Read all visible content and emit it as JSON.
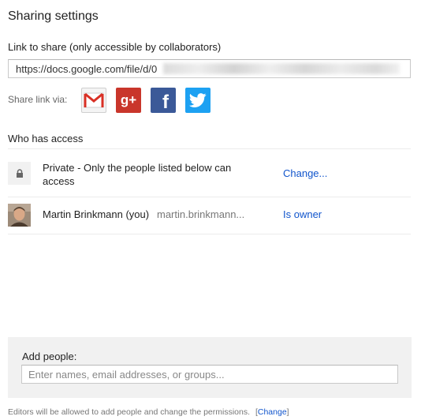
{
  "dialog": {
    "title": "Sharing settings"
  },
  "link_share": {
    "label": "Link to share (only accessible by collaborators)",
    "url_prefix": "https://docs.google.com/file/d/0"
  },
  "share_via": {
    "label": "Share link via:",
    "services": [
      {
        "name": "gmail-icon",
        "color": "#d93025"
      },
      {
        "name": "google-plus-icon",
        "text": "g+",
        "color": "#c9362b"
      },
      {
        "name": "facebook-icon",
        "text": "f",
        "color": "#3b5998"
      },
      {
        "name": "twitter-icon",
        "color": "#1da1f2"
      }
    ]
  },
  "access": {
    "heading": "Who has access",
    "rows": [
      {
        "icon": "lock-icon",
        "text": "Private - Only the people listed below can access",
        "action": "Change..."
      },
      {
        "icon": "avatar",
        "name": "Martin Brinkmann (you)",
        "email": "martin.brinkmann...",
        "role": "Is owner"
      }
    ]
  },
  "add_people": {
    "label": "Add people:",
    "placeholder": "Enter names, email addresses, or groups..."
  },
  "footer": {
    "text": "Editors will be allowed to add people and change the permissions.",
    "link_open": "[",
    "link": "Change",
    "link_close": "]"
  },
  "colors": {
    "link": "#1155cc",
    "panel_bg": "#f1f1f1"
  }
}
